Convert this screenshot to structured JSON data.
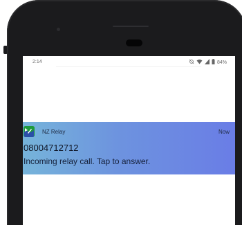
{
  "status_bar": {
    "time": "2:14",
    "battery_percent": "84%",
    "icons": [
      "dnd-off-icon",
      "wifi-icon",
      "signal-icon",
      "battery-icon"
    ]
  },
  "notification": {
    "app_name": "NZ Relay",
    "time": "Now",
    "title": "08004712712",
    "body": "Incoming relay call. Tap to answer.",
    "colors": {
      "gradient_start": "#76b4da",
      "gradient_end": "#6a7de6"
    }
  }
}
